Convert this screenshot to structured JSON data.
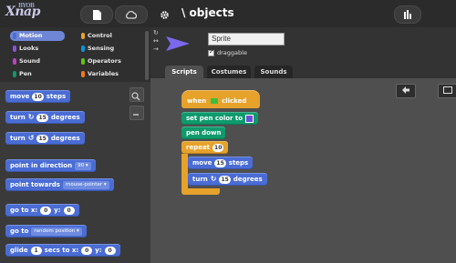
{
  "logo": {
    "text": "Xnap",
    "sub": "BYOB"
  },
  "topbar": {
    "project_title": "\\ objects",
    "file_icon": "file-icon",
    "cloud_icon": "cloud-icon",
    "gear_icon": "gear-icon",
    "stage_icon": "stage-size-icon"
  },
  "categories": [
    {
      "label": "Motion",
      "color": "#4a6cd4",
      "selected": true
    },
    {
      "label": "Control",
      "color": "#e6a22a",
      "selected": false
    },
    {
      "label": "Looks",
      "color": "#8a55d7",
      "selected": false
    },
    {
      "label": "Sensing",
      "color": "#0494dc",
      "selected": false
    },
    {
      "label": "Sound",
      "color": "#bb42c3",
      "selected": false
    },
    {
      "label": "Operators",
      "color": "#62c213",
      "selected": false
    },
    {
      "label": "Pen",
      "color": "#0e9a6c",
      "selected": false
    },
    {
      "label": "Variables",
      "color": "#f3761d",
      "selected": false
    }
  ],
  "palette": {
    "move": {
      "pre": "move",
      "num": "10",
      "post": "steps"
    },
    "turn_cw": {
      "pre": "turn",
      "sym": "↻",
      "num": "15",
      "post": "degrees"
    },
    "turn_ccw": {
      "pre": "turn",
      "sym": "↺",
      "num": "15",
      "post": "degrees"
    },
    "point_dir": {
      "pre": "point in direction",
      "dd": "90 ▾"
    },
    "point_towards": {
      "pre": "point towards",
      "dd": "mouse-pointer ▾"
    },
    "go_to_xy": {
      "pre": "go to x:",
      "x": "0",
      "mid": "y:",
      "y": "0"
    },
    "go_to": {
      "pre": "go to",
      "dd": "random position ▾"
    },
    "glide": {
      "pre": "glide",
      "secs": "1",
      "mid": "secs to x:",
      "x": "0",
      "mid2": "y:",
      "y": "0"
    }
  },
  "sprite": {
    "name": "Sprite",
    "draggable_label": "draggable",
    "draggable_checked": true,
    "rotation_symbols": [
      "↻",
      "↔",
      "→"
    ]
  },
  "tabs": [
    {
      "label": "Scripts",
      "active": true
    },
    {
      "label": "Costumes",
      "active": false
    },
    {
      "label": "Sounds",
      "active": false
    }
  ],
  "script": {
    "hat": {
      "pre": "when",
      "post": "clicked"
    },
    "set_pen_color": "set pen color to",
    "pen_down": "pen down",
    "repeat": {
      "label": "repeat",
      "num": "10"
    },
    "move": {
      "pre": "move",
      "num": "15",
      "post": "steps"
    },
    "turn": {
      "pre": "turn",
      "sym": "↻",
      "num": "15",
      "post": "degrees"
    }
  },
  "script_buttons": {
    "undo_icon": "undo-icon",
    "keyboard_icon": "keyboard-icon"
  }
}
